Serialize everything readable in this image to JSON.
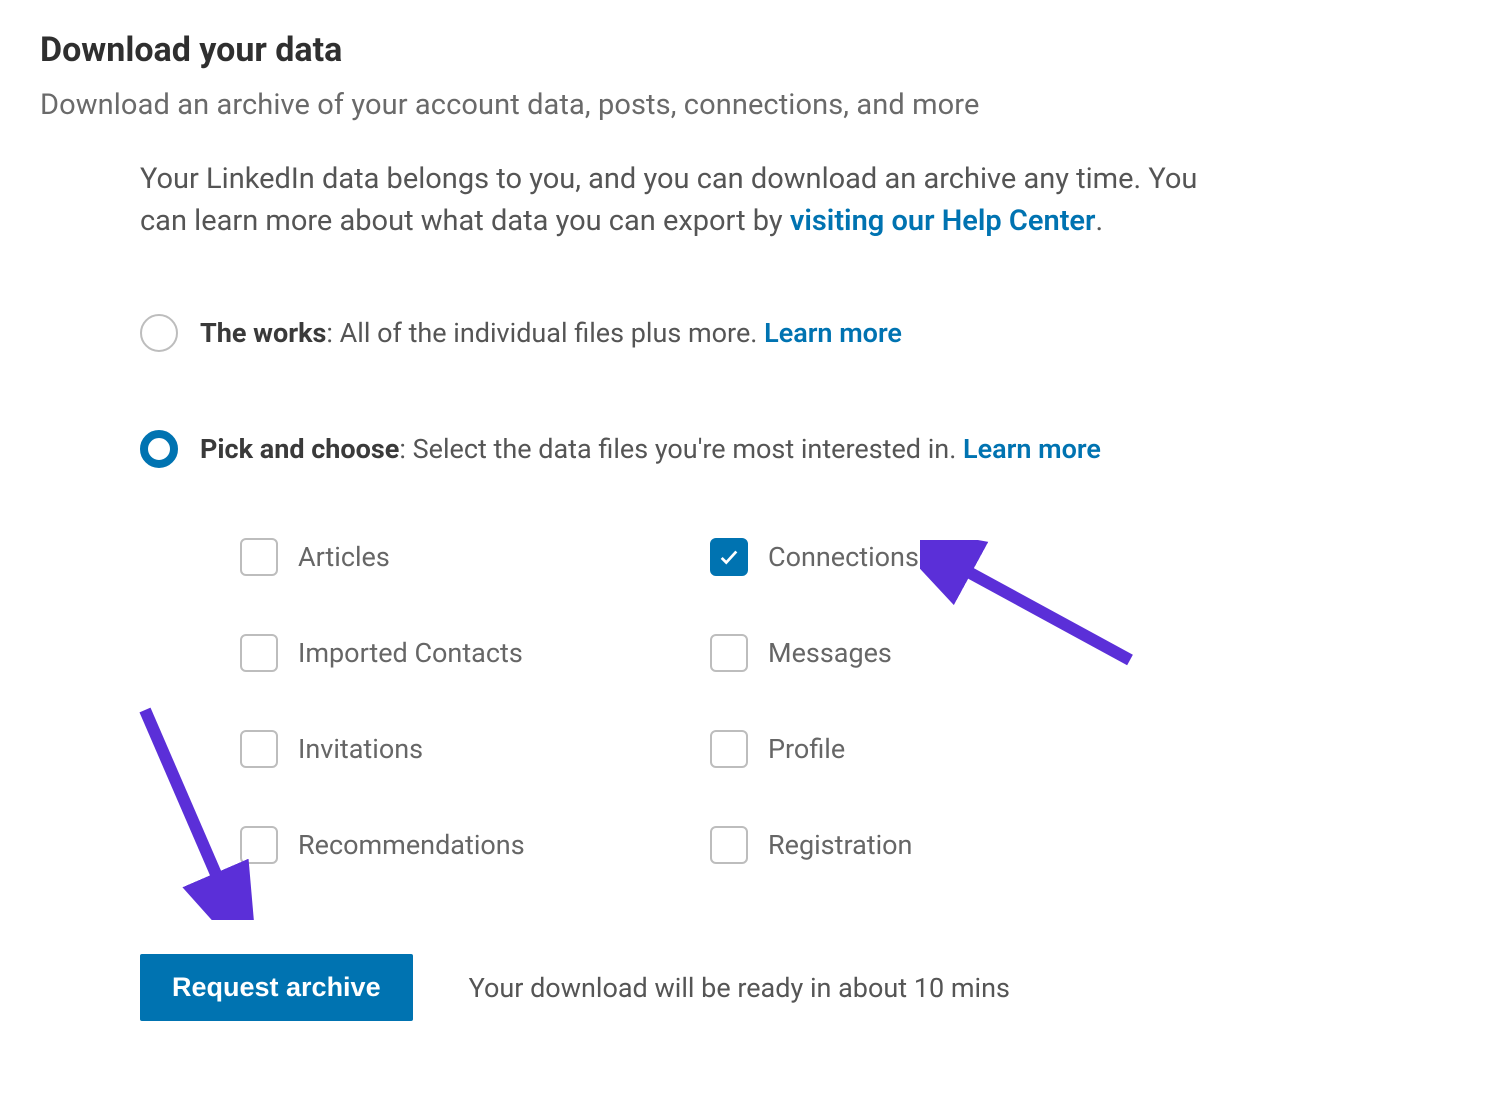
{
  "title": "Download your data",
  "subtitle": "Download an archive of your account data, posts, connections, and more",
  "description": {
    "text_before_link": "Your LinkedIn data belongs to you, and you can download an archive any time. You can learn more about what data you can export by ",
    "link_text": "visiting our Help Center",
    "text_after_link": "."
  },
  "radio_options": [
    {
      "selected": false,
      "bold_label": "The works",
      "rest": ": All of the individual files plus more. ",
      "learn_more": "Learn more"
    },
    {
      "selected": true,
      "bold_label": "Pick and choose",
      "rest": ": Select the data files you're most interested in. ",
      "learn_more": "Learn more"
    }
  ],
  "checkboxes": [
    {
      "label": "Articles",
      "checked": false
    },
    {
      "label": "Connections",
      "checked": true
    },
    {
      "label": "Imported Contacts",
      "checked": false
    },
    {
      "label": "Messages",
      "checked": false
    },
    {
      "label": "Invitations",
      "checked": false
    },
    {
      "label": "Profile",
      "checked": false
    },
    {
      "label": "Recommendations",
      "checked": false
    },
    {
      "label": "Registration",
      "checked": false
    }
  ],
  "button_label": "Request archive",
  "footer_text": "Your download will be ready in about 10 mins",
  "colors": {
    "brand": "#0073b1",
    "annotation_arrow": "#5b2fd8"
  }
}
